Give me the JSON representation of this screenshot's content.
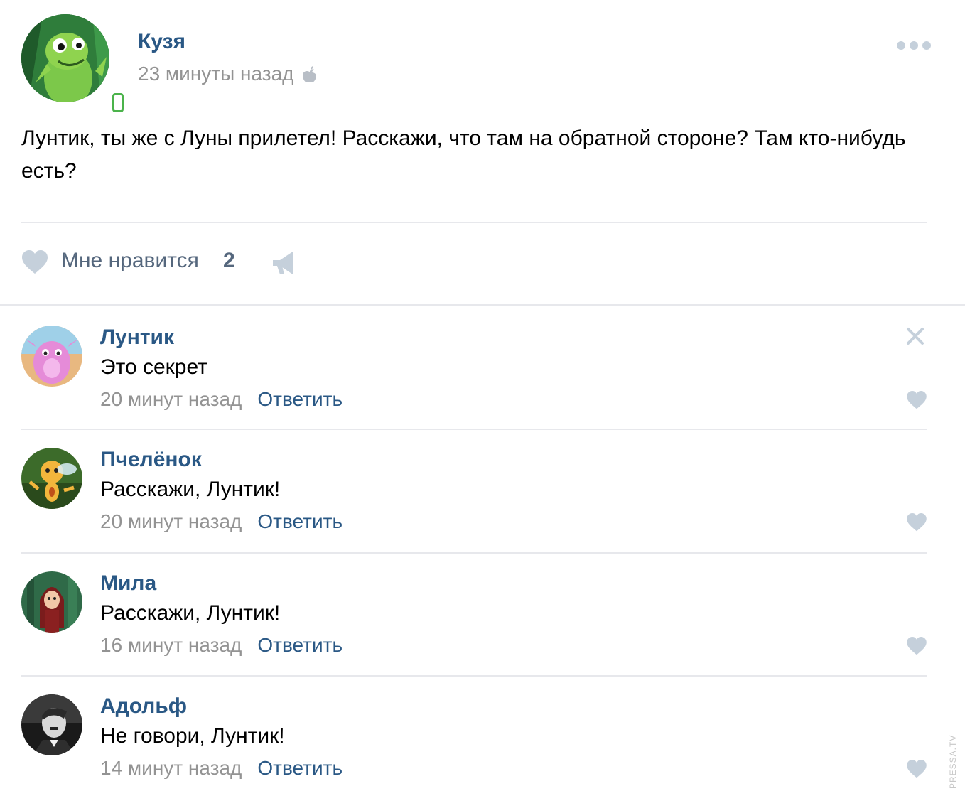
{
  "post": {
    "author": "Кузя",
    "time": "23 минуты назад",
    "platform_icon": "apple-icon",
    "text": "Лунтик, ты же с Луны прилетел! Расскажи, что там на обратной стороне? Там кто-нибудь есть?",
    "like_label": "Мне нравится",
    "like_count": "2"
  },
  "comments": [
    {
      "name": "Лунтик",
      "text": "Это секрет",
      "time": "20 минут назад",
      "reply": "Ответить"
    },
    {
      "name": "Пчелёнок",
      "text": "Расскажи, Лунтик!",
      "time": "20 минут назад",
      "reply": "Ответить"
    },
    {
      "name": "Мила",
      "text": "Расскажи, Лунтик!",
      "time": "16 минут назад",
      "reply": "Ответить"
    },
    {
      "name": "Адольф",
      "text": "Не говори, Лунтик!",
      "time": "14 минут назад",
      "reply": "Ответить"
    }
  ],
  "watermark": "PRESSA.TV",
  "colors": {
    "link": "#2a5885",
    "muted": "#939393",
    "action": "#55677d",
    "icon_light": "#c5d0db",
    "separator": "#e7e8ec",
    "online": "#4bb34b"
  }
}
